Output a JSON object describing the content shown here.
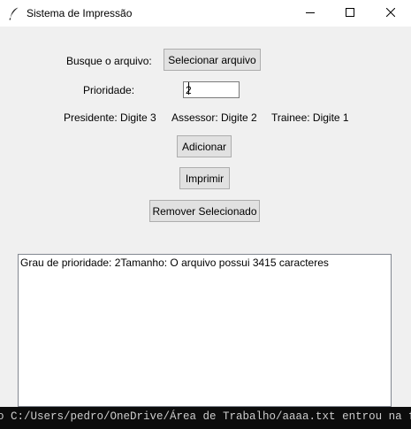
{
  "window": {
    "title": "Sistema de Impressão",
    "icon": "feather-icon",
    "controls": [
      "minimize-icon",
      "maximize-icon",
      "close-icon"
    ]
  },
  "form": {
    "file_label": "Busque o arquivo:",
    "select_file_button": "Selecionar arquivo",
    "priority_label": "Prioridade:",
    "priority_value": "2",
    "roles": {
      "presidente": "Presidente: Digite 3",
      "assessor": "Assessor: Digite 2",
      "trainee": "Trainee: Digite 1"
    },
    "add_button": "Adicionar",
    "print_button": "Imprimir",
    "remove_button": "Remover Selecionado"
  },
  "queue": {
    "items": [
      "Grau de prioridade: 2Tamanho: O arquivo possui 3415 caracteres"
    ]
  },
  "console": {
    "text": "o C:/Users/pedro/OneDrive/Área de Trabalho/aaaa.txt entrou na fila"
  }
}
